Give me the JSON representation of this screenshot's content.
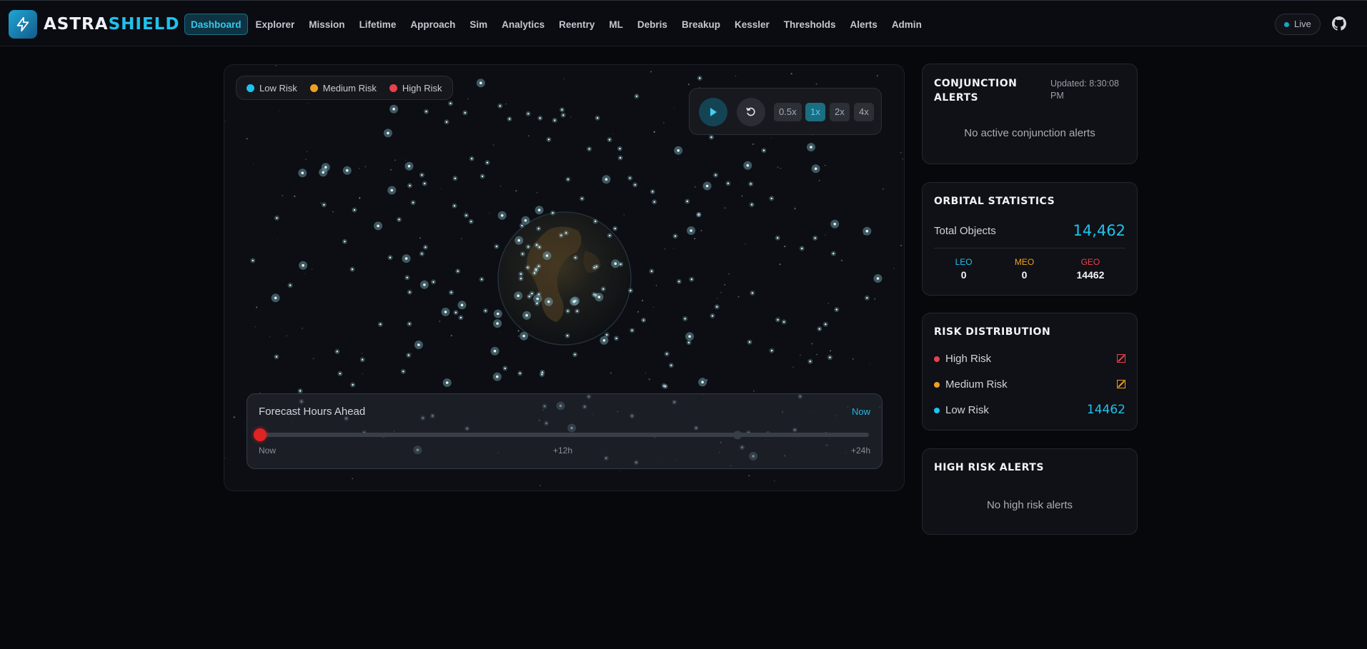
{
  "brand": {
    "part1": "ASTRA",
    "part2": "SHIELD"
  },
  "nav": {
    "items": [
      "Dashboard",
      "Explorer",
      "Mission",
      "Lifetime",
      "Approach",
      "Sim",
      "Analytics",
      "Reentry",
      "ML",
      "Debris",
      "Breakup",
      "Kessler",
      "Thresholds",
      "Alerts",
      "Admin"
    ],
    "active": "Dashboard"
  },
  "header": {
    "live_label": "Live"
  },
  "legend": {
    "low": "Low Risk",
    "medium": "Medium Risk",
    "high": "High Risk"
  },
  "colors": {
    "accent": "#1fc2ee",
    "low": "#1fc2ee",
    "medium": "#f0a020",
    "high": "#e8424c"
  },
  "playback": {
    "speeds": [
      "0.5x",
      "1x",
      "2x",
      "4x"
    ],
    "selected": "1x"
  },
  "forecast": {
    "title": "Forecast Hours Ahead",
    "current": "Now",
    "tick_start": "Now",
    "tick_mid": "+12h",
    "tick_end": "+24h",
    "value_hours": 0
  },
  "conjunction": {
    "title_line1": "CONJUNCTION",
    "title_line2": "ALERTS",
    "updated": "Updated: 8:30:08 PM",
    "empty": "No active conjunction alerts"
  },
  "orbital": {
    "title": "ORBITAL STATISTICS",
    "total_label": "Total Objects",
    "total_value": "14,462",
    "leo_label": "LEO",
    "leo_value": "0",
    "meo_label": "MEO",
    "meo_value": "0",
    "geo_label": "GEO",
    "geo_value": "14462"
  },
  "risk": {
    "title": "RISK DISTRIBUTION",
    "high_label": "High Risk",
    "medium_label": "Medium Risk",
    "low_label": "Low Risk",
    "low_value": "14462"
  },
  "high_risk": {
    "title": "HIGH RISK ALERTS",
    "empty": "No high risk alerts"
  }
}
